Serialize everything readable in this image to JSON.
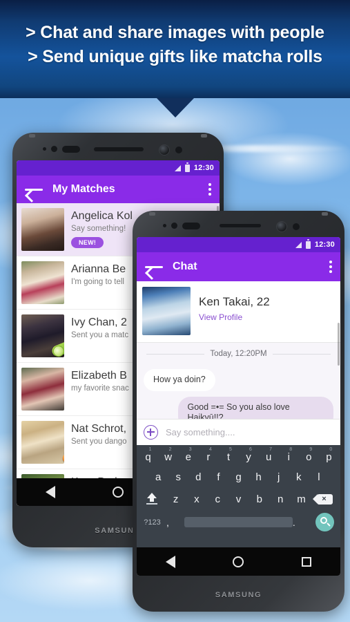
{
  "banner": {
    "line1": "> Chat and share images with people",
    "line2": "> Send unique gifts like matcha rolls"
  },
  "left_phone": {
    "brand": "SAMSUNG",
    "status": {
      "time": "12:30",
      "signal_icon": "signal-icon",
      "battery_icon": "battery-icon"
    },
    "appbar": {
      "title": "My Matches",
      "back_icon": "back-arrow-icon",
      "menu_icon": "overflow-menu-icon"
    },
    "matches": [
      {
        "name": "Angelica Kol",
        "sub": "Say something!",
        "badge": "NEW!",
        "gift": "",
        "avatar_class": "ph-ang",
        "unread": true
      },
      {
        "name": "Arianna Be",
        "sub": "I'm going to tell",
        "badge": "",
        "gift": "",
        "avatar_class": "ph-ari",
        "unread": false
      },
      {
        "name": "Ivy Chan, 2",
        "sub": "Sent you a matc",
        "badge": "",
        "gift": "matcha",
        "avatar_class": "ph-ivy",
        "unread": false
      },
      {
        "name": "Elizabeth B",
        "sub": "my favorite snac",
        "badge": "",
        "gift": "",
        "avatar_class": "ph-eli",
        "unread": false
      },
      {
        "name": "Nat Schrot,",
        "sub": "Sent you dango",
        "badge": "",
        "gift": "dango",
        "avatar_class": "ph-nat",
        "unread": false
      },
      {
        "name": "Kara Park,",
        "sub": "",
        "badge": "",
        "gift": "",
        "avatar_class": "ph-kar",
        "unread": false
      }
    ],
    "nav": {
      "back": "nav-back-icon",
      "home": "nav-home-icon",
      "recent": "nav-recent-icon"
    }
  },
  "right_phone": {
    "brand": "SAMSUNG",
    "status": {
      "time": "12:30",
      "signal_icon": "signal-icon",
      "battery_icon": "battery-icon"
    },
    "appbar": {
      "title": "Chat",
      "back_icon": "back-arrow-icon",
      "menu_icon": "overflow-menu-icon"
    },
    "contact": {
      "name": "Ken Takai, 22",
      "view_profile": "View Profile"
    },
    "date_divider": "Today, 12:20PM",
    "messages": [
      {
        "dir": "in",
        "text": "How ya doin?"
      },
      {
        "dir": "out",
        "text": "Good =•= So you also love Haikyū!!?"
      }
    ],
    "input": {
      "placeholder": "Say something....",
      "plus_icon": "plus-circle-icon"
    },
    "keyboard": {
      "row1": [
        {
          "k": "q",
          "n": "1"
        },
        {
          "k": "w",
          "n": "2"
        },
        {
          "k": "e",
          "n": "3"
        },
        {
          "k": "r",
          "n": "4"
        },
        {
          "k": "t",
          "n": "5"
        },
        {
          "k": "y",
          "n": "6"
        },
        {
          "k": "u",
          "n": "7"
        },
        {
          "k": "i",
          "n": "8"
        },
        {
          "k": "o",
          "n": "9"
        },
        {
          "k": "p",
          "n": "0"
        }
      ],
      "row2": [
        "a",
        "s",
        "d",
        "f",
        "g",
        "h",
        "j",
        "k",
        "l"
      ],
      "row3": [
        "z",
        "x",
        "c",
        "v",
        "b",
        "n",
        "m"
      ],
      "sym_key": "?123",
      "comma_key": ",",
      "period_key": ".",
      "shift_icon": "shift-icon",
      "delete_icon": "backspace-icon",
      "space_icon": "spacebar",
      "search_icon": "search-icon"
    },
    "nav": {
      "back": "nav-back-icon",
      "home": "nav-home-icon",
      "recent": "nav-recent-icon"
    }
  },
  "colors": {
    "banner_blue": "#14539c",
    "status_purple": "#6521cf",
    "appbar_purple": "#8a2be8",
    "accent_purple": "#9b51e0",
    "unread_row": "#efe4f7",
    "bubble_out": "#e7dcee",
    "keyboard_bg": "#3a4149",
    "search_teal": "#72c4bd"
  }
}
